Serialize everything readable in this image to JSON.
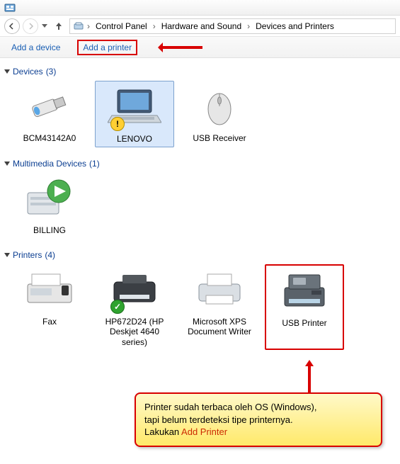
{
  "titlebar": {
    "icon": "control-panel"
  },
  "breadcrumb": {
    "items": [
      {
        "label": "Control Panel"
      },
      {
        "label": "Hardware and Sound"
      },
      {
        "label": "Devices and Printers"
      }
    ]
  },
  "commands": {
    "add_device": "Add a device",
    "add_printer": "Add a printer"
  },
  "groups": [
    {
      "name": "Devices",
      "count": "(3)",
      "items": [
        {
          "id": "bcm",
          "label": "BCM43142A0",
          "icon": "usb-dongle",
          "selected": false
        },
        {
          "id": "lenovo",
          "label": "LENOVO",
          "icon": "laptop",
          "selected": true,
          "badge": "warn"
        },
        {
          "id": "usb-recv",
          "label": "USB Receiver",
          "icon": "mouse",
          "selected": false
        }
      ]
    },
    {
      "name": "Multimedia Devices",
      "count": "(1)",
      "items": [
        {
          "id": "billing",
          "label": "BILLING",
          "icon": "media-pc",
          "selected": false
        }
      ]
    },
    {
      "name": "Printers",
      "count": "(4)",
      "items": [
        {
          "id": "fax",
          "label": "Fax",
          "icon": "fax",
          "selected": false
        },
        {
          "id": "hp",
          "label": "HP672D24 (HP Deskjet 4640 series)",
          "icon": "printer-deskjet",
          "selected": false,
          "badge": "ok"
        },
        {
          "id": "xps",
          "label": "Microsoft XPS Document Writer",
          "icon": "printer-generic",
          "selected": false
        },
        {
          "id": "usbprinter",
          "label": "USB Printer",
          "icon": "printer-mfp",
          "selected": false,
          "highlight": true
        }
      ]
    }
  ],
  "callout": {
    "line1": "Printer sudah terbaca oleh OS (Windows),",
    "line2": "tapi belum terdeteksi tipe printernya.",
    "line3_a": "Lakukan ",
    "line3_b": "Add Printer"
  }
}
